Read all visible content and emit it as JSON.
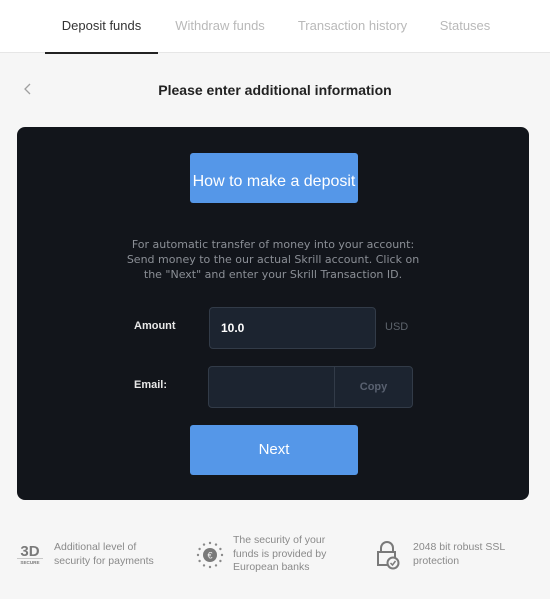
{
  "tabs": [
    {
      "label": "Deposit funds",
      "active": true
    },
    {
      "label": "Withdraw funds",
      "active": false
    },
    {
      "label": "Transaction history",
      "active": false
    },
    {
      "label": "Statuses",
      "active": false
    }
  ],
  "header": {
    "back_icon": "chevron-left-icon",
    "title": "Please enter additional information"
  },
  "panel": {
    "how_to_button": "How to make a deposit",
    "info_lines": [
      "For automatic transfer of money into your account:",
      "Send money to the our actual Skrill account. Click on",
      "the \"Next\" and enter your Skrill Transaction ID."
    ],
    "amount": {
      "label": "Amount",
      "value": "10.0",
      "currency": "USD"
    },
    "email": {
      "label": "Email:",
      "value": "",
      "copy_label": "Copy"
    },
    "next_button": "Next"
  },
  "features": [
    {
      "icon": "3d-secure-icon",
      "icon_text_main": "3D",
      "icon_text_sub": "SECURE",
      "text": "Additional level of security for payments"
    },
    {
      "icon": "euro-stars-icon",
      "text": "The security of your funds is provided by European banks"
    },
    {
      "icon": "lock-check-icon",
      "text": "2048 bit robust SSL protection"
    }
  ],
  "colors": {
    "accent": "#5597e8",
    "panel_bg": "#12151b",
    "field_bg": "#1c2430",
    "page_bg": "#f6f6f6"
  }
}
